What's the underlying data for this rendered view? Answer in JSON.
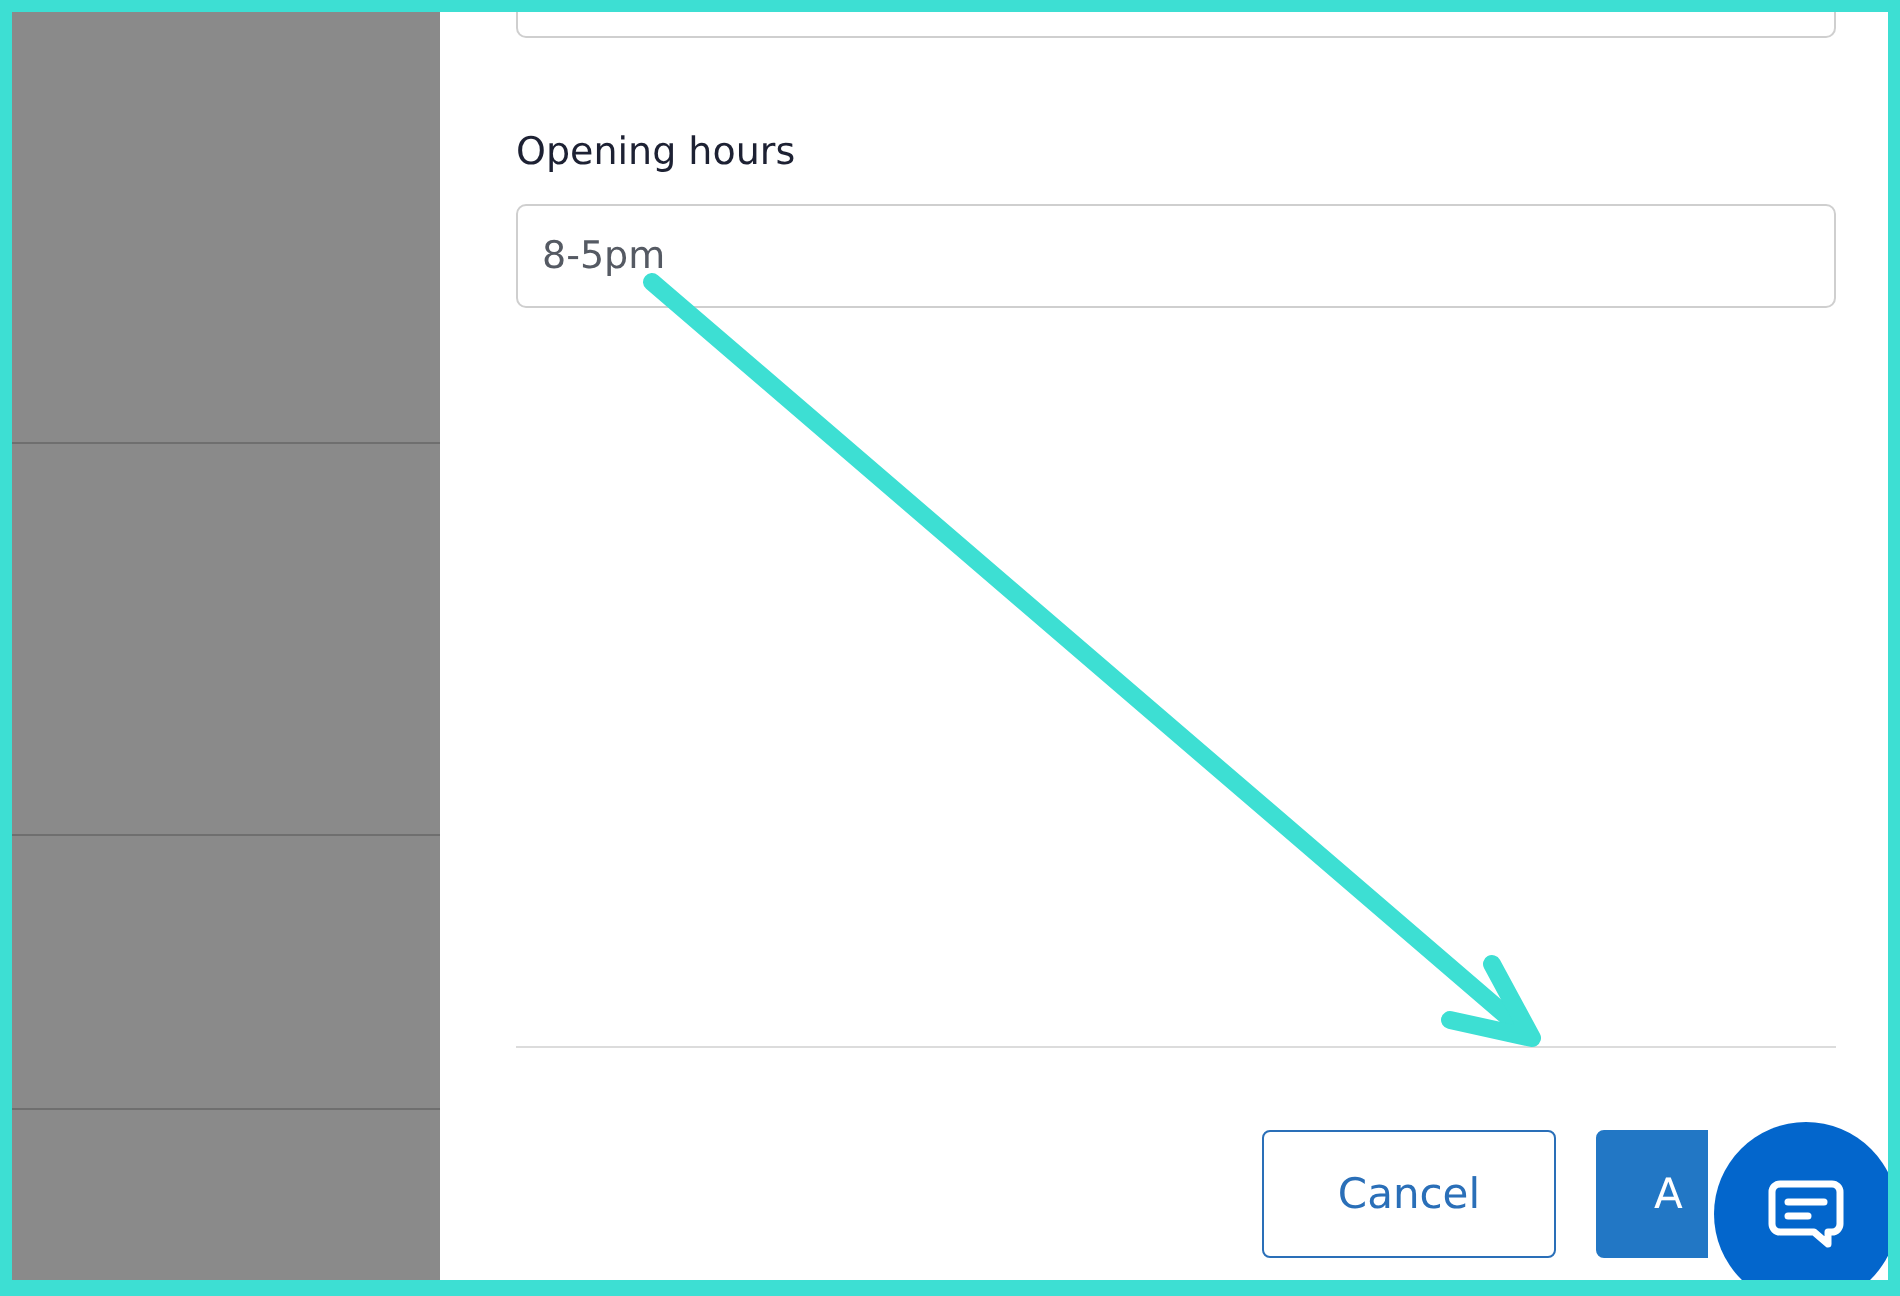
{
  "form": {
    "field": {
      "label": "Opening hours",
      "value": "8-5pm"
    }
  },
  "buttons": [
    {
      "label": "Cancel",
      "kind": "secondary"
    },
    {
      "label": "A",
      "kind": "primary"
    }
  ]
}
